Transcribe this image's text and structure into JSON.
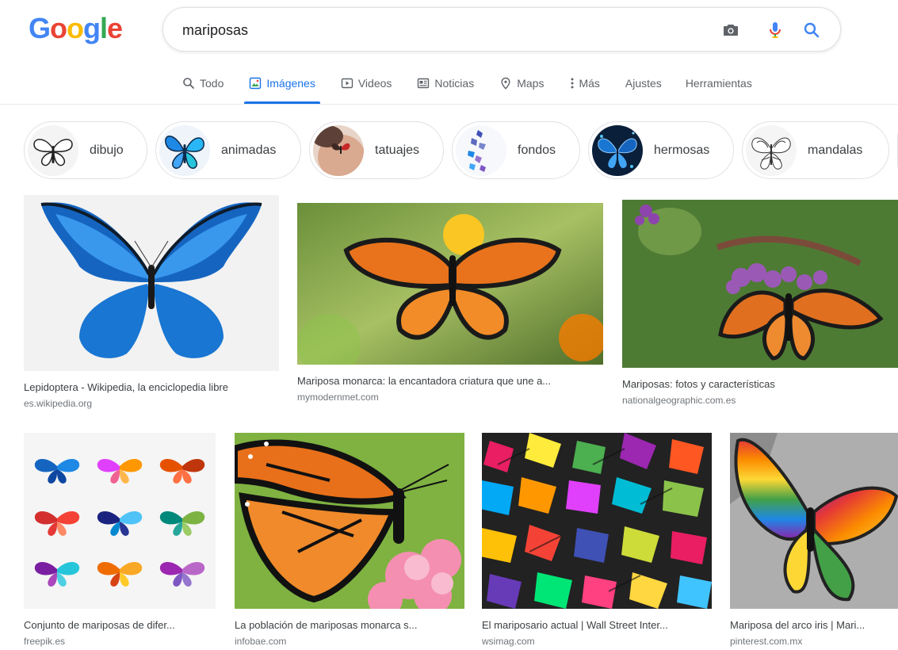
{
  "logo": {
    "letters": [
      "G",
      "o",
      "o",
      "g",
      "l",
      "e"
    ],
    "colors": [
      "#4285f4",
      "#ea4335",
      "#fbbc05",
      "#4285f4",
      "#34a853",
      "#ea4335"
    ]
  },
  "search": {
    "query": "mariposas",
    "camera_icon": "camera-icon",
    "mic_icon": "microphone-icon",
    "search_icon": "search-icon"
  },
  "tabs": [
    {
      "label": "Todo",
      "icon": "search-icon"
    },
    {
      "label": "Imágenes",
      "icon": "image-icon",
      "active": true
    },
    {
      "label": "Videos",
      "icon": "play-icon"
    },
    {
      "label": "Noticias",
      "icon": "newspaper-icon"
    },
    {
      "label": "Maps",
      "icon": "location-pin-icon"
    },
    {
      "label": "Más",
      "icon": "more-vertical-icon"
    },
    {
      "label": "Ajustes"
    },
    {
      "label": "Herramientas"
    }
  ],
  "chips": [
    {
      "label": "dibujo"
    },
    {
      "label": "animadas"
    },
    {
      "label": "tatuajes"
    },
    {
      "label": "fondos"
    },
    {
      "label": "hermosas"
    },
    {
      "label": "mandalas"
    }
  ],
  "results": [
    {
      "title": "Lepidoptera - Wikipedia, la enciclopedia libre",
      "source": "es.wikipedia.org"
    },
    {
      "title": "Mariposa monarca: la encantadora criatura que une a...",
      "source": "mymodernmet.com"
    },
    {
      "title": "Mariposas: fotos y características",
      "source": "nationalgeographic.com.es"
    },
    {
      "title": "Conjunto de mariposas de difer...",
      "source": "freepik.es"
    },
    {
      "title": "La población de mariposas monarca s...",
      "source": "infobae.com"
    },
    {
      "title": "El mariposario actual | Wall Street Inter...",
      "source": "wsimag.com"
    },
    {
      "title": "Mariposa del arco iris | Mari...",
      "source": "pinterest.com.mx"
    }
  ],
  "colors": {
    "accent": "#1a73e8",
    "text_secondary": "#5f6368",
    "source_gray": "#70757a"
  }
}
